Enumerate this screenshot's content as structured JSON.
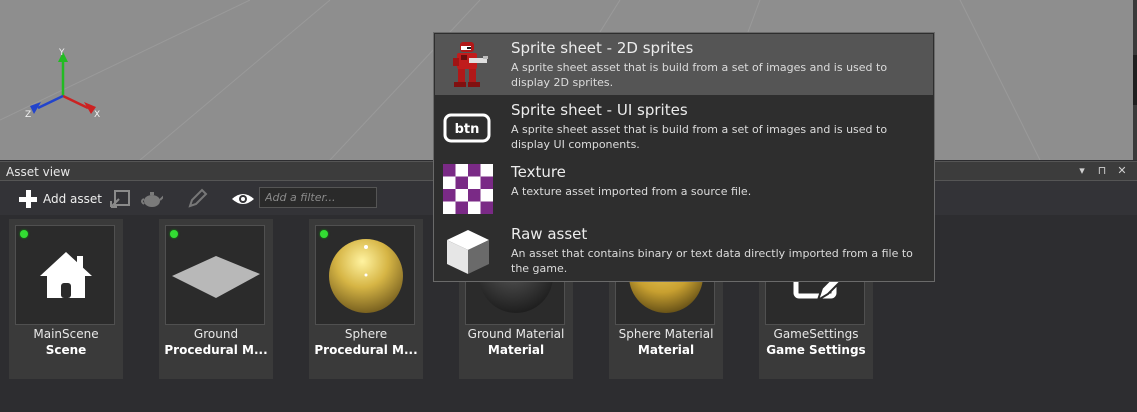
{
  "viewport": {
    "gizmo": {
      "y_label": "Y",
      "z_label": "Z",
      "x_label": "X"
    }
  },
  "asset_view": {
    "title": "Asset view",
    "window_controls": [
      "▾",
      "⊓",
      "✕"
    ],
    "toolbar": {
      "add_asset_label": "Add asset",
      "filter_placeholder": "Add a filter..."
    },
    "tiles": [
      {
        "name": "MainScene",
        "type": "Scene",
        "status": "green",
        "thumb": "house-icon"
      },
      {
        "name": "Ground",
        "type": "Procedural M...",
        "status": "green",
        "thumb": "plane"
      },
      {
        "name": "Sphere",
        "type": "Procedural M...",
        "status": "green",
        "thumb": "gold-sphere"
      },
      {
        "name": "Ground Material",
        "type": "Material",
        "status": "none",
        "thumb": "dark-sphere"
      },
      {
        "name": "Sphere Material",
        "type": "Material",
        "status": "none",
        "thumb": "gold-sphere"
      },
      {
        "name": "GameSettings",
        "type": "Game Settings",
        "status": "none",
        "thumb": "settings-icon"
      }
    ]
  },
  "new_asset_menu": {
    "items": [
      {
        "title": "Sprite sheet - 2D sprites",
        "description": "A sprite sheet asset that is build from a set of images and is used to display 2D sprites.",
        "icon": "robot-sprite-icon",
        "selected": true
      },
      {
        "title": "Sprite sheet - UI sprites",
        "description": "A sprite sheet asset that is build from a set of images and is used to display UI components.",
        "icon": "btn-icon",
        "icon_text": "btn",
        "selected": false
      },
      {
        "title": "Texture",
        "description": "A texture asset imported from a source file.",
        "icon": "checker-texture-icon",
        "selected": false
      },
      {
        "title": "Raw asset",
        "description": "An asset that contains binary or text data directly imported from a file to the game.",
        "icon": "cube-icon",
        "selected": false
      }
    ]
  },
  "colors": {
    "accent_purple": "#7a2a86",
    "status_green": "#33dd33",
    "selection": "#555555",
    "gold": "#d4b440"
  }
}
